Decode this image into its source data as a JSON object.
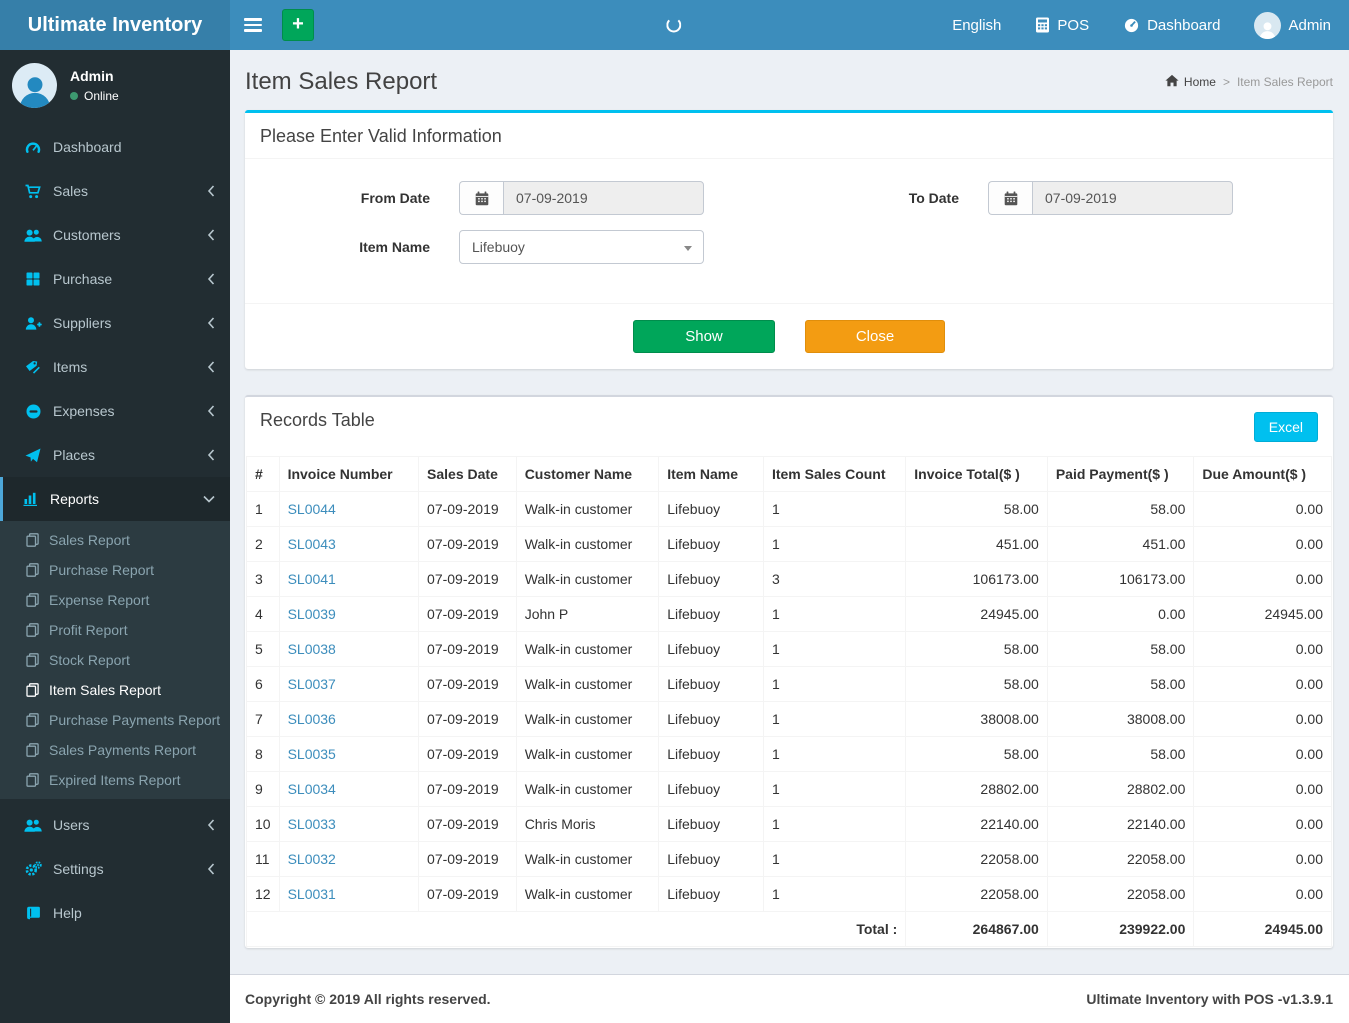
{
  "topbar": {
    "brand": "Ultimate Inventory",
    "nav": {
      "language": "English",
      "pos": "POS",
      "dashboard": "Dashboard",
      "user": "Admin"
    }
  },
  "sidebar": {
    "user_name": "Admin",
    "user_status": "Online",
    "menu": [
      {
        "label": "Dashboard"
      },
      {
        "label": "Sales"
      },
      {
        "label": "Customers"
      },
      {
        "label": "Purchase"
      },
      {
        "label": "Suppliers"
      },
      {
        "label": "Items"
      },
      {
        "label": "Expenses"
      },
      {
        "label": "Places"
      },
      {
        "label": "Reports"
      },
      {
        "label": "Users"
      },
      {
        "label": "Settings"
      },
      {
        "label": "Help"
      }
    ],
    "reports_submenu": [
      "Sales Report",
      "Purchase Report",
      "Expense Report",
      "Profit Report",
      "Stock Report",
      "Item Sales Report",
      "Purchase Payments Report",
      "Sales Payments Report",
      "Expired Items Report"
    ],
    "active_item": "Reports",
    "active_submenu_item": "Item Sales Report"
  },
  "page": {
    "title": "Item Sales Report",
    "breadcrumb_home": "Home",
    "breadcrumb_current": "Item Sales Report"
  },
  "filter": {
    "panel_title": "Please Enter Valid Information",
    "from_date_label": "From Date",
    "from_date_value": "07-09-2019",
    "to_date_label": "To Date",
    "to_date_value": "07-09-2019",
    "item_name_label": "Item Name",
    "item_name_value": "Lifebuoy",
    "show_button": "Show",
    "close_button": "Close"
  },
  "records": {
    "panel_title": "Records Table",
    "excel_button": "Excel",
    "columns": [
      "#",
      "Invoice Number",
      "Sales Date",
      "Customer Name",
      "Item Name",
      "Item Sales Count",
      "Invoice Total($ )",
      "Paid Payment($ )",
      "Due Amount($ )"
    ],
    "rows": [
      [
        "1",
        "SL0044",
        "07-09-2019",
        "Walk-in customer",
        "Lifebuoy",
        "1",
        "58.00",
        "58.00",
        "0.00"
      ],
      [
        "2",
        "SL0043",
        "07-09-2019",
        "Walk-in customer",
        "Lifebuoy",
        "1",
        "451.00",
        "451.00",
        "0.00"
      ],
      [
        "3",
        "SL0041",
        "07-09-2019",
        "Walk-in customer",
        "Lifebuoy",
        "3",
        "106173.00",
        "106173.00",
        "0.00"
      ],
      [
        "4",
        "SL0039",
        "07-09-2019",
        "John P",
        "Lifebuoy",
        "1",
        "24945.00",
        "0.00",
        "24945.00"
      ],
      [
        "5",
        "SL0038",
        "07-09-2019",
        "Walk-in customer",
        "Lifebuoy",
        "1",
        "58.00",
        "58.00",
        "0.00"
      ],
      [
        "6",
        "SL0037",
        "07-09-2019",
        "Walk-in customer",
        "Lifebuoy",
        "1",
        "58.00",
        "58.00",
        "0.00"
      ],
      [
        "7",
        "SL0036",
        "07-09-2019",
        "Walk-in customer",
        "Lifebuoy",
        "1",
        "38008.00",
        "38008.00",
        "0.00"
      ],
      [
        "8",
        "SL0035",
        "07-09-2019",
        "Walk-in customer",
        "Lifebuoy",
        "1",
        "58.00",
        "58.00",
        "0.00"
      ],
      [
        "9",
        "SL0034",
        "07-09-2019",
        "Walk-in customer",
        "Lifebuoy",
        "1",
        "28802.00",
        "28802.00",
        "0.00"
      ],
      [
        "10",
        "SL0033",
        "07-09-2019",
        "Chris Moris",
        "Lifebuoy",
        "1",
        "22140.00",
        "22140.00",
        "0.00"
      ],
      [
        "11",
        "SL0032",
        "07-09-2019",
        "Walk-in customer",
        "Lifebuoy",
        "1",
        "22058.00",
        "22058.00",
        "0.00"
      ],
      [
        "12",
        "SL0031",
        "07-09-2019",
        "Walk-in customer",
        "Lifebuoy",
        "1",
        "22058.00",
        "22058.00",
        "0.00"
      ]
    ],
    "total_label": "Total :",
    "totals": [
      "264867.00",
      "239922.00",
      "24945.00"
    ]
  },
  "footer": {
    "copyright": "Copyright © 2019 All rights reserved.",
    "version_text": "Ultimate Inventory with POS -v1.3.9.1"
  },
  "colors": {
    "topbar": "#3c8dbc",
    "brand_bg": "#367fa9",
    "sidebar_bg": "#222d32",
    "submenu_bg": "#2c3b41",
    "accent_cyan": "#00c0ef",
    "button_green": "#00a65a",
    "button_orange": "#f39c12",
    "link_blue": "#3c8dbc",
    "online_green": "#3d9970",
    "content_bg": "#ecf0f5"
  }
}
